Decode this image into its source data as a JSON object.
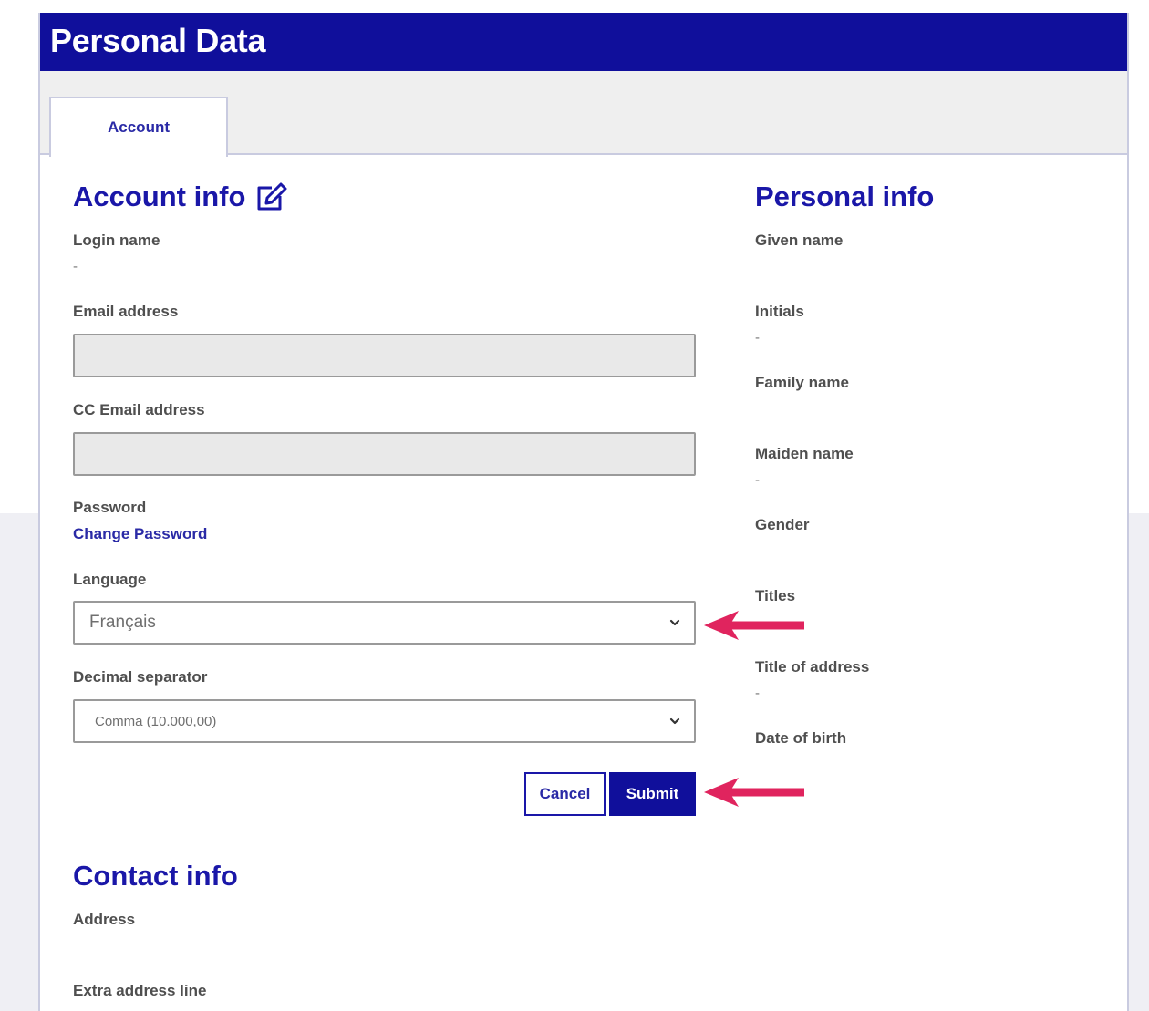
{
  "header": {
    "title": "Personal Data"
  },
  "tabs": [
    {
      "label": "Account"
    }
  ],
  "account_info": {
    "title": "Account info",
    "login_name": {
      "label": "Login name",
      "value": "-"
    },
    "email": {
      "label": "Email address",
      "value": ""
    },
    "cc_email": {
      "label": "CC Email address",
      "value": ""
    },
    "password": {
      "label": "Password",
      "link": "Change Password"
    },
    "language": {
      "label": "Language",
      "selected": "Français"
    },
    "decimal_separator": {
      "label": "Decimal separator",
      "selected": "Comma (10.000,00)"
    },
    "cancel_label": "Cancel",
    "submit_label": "Submit"
  },
  "personal_info": {
    "title": "Personal info",
    "fields": [
      {
        "label": "Given name",
        "value": ""
      },
      {
        "label": "Initials",
        "value": "-"
      },
      {
        "label": "Family name",
        "value": ""
      },
      {
        "label": "Maiden name",
        "value": "-"
      },
      {
        "label": "Gender",
        "value": ""
      },
      {
        "label": "Titles",
        "value": ""
      },
      {
        "label": "Title of address",
        "value": "-"
      },
      {
        "label": "Date of birth",
        "value": ""
      }
    ]
  },
  "contact_info": {
    "title": "Contact info",
    "fields": [
      {
        "label": "Address",
        "value": ""
      },
      {
        "label": "Extra address line",
        "value": ""
      }
    ]
  },
  "colors": {
    "brand": "#100f9b",
    "heading": "#1a17a8",
    "annotation_arrow": "#e0245e"
  }
}
